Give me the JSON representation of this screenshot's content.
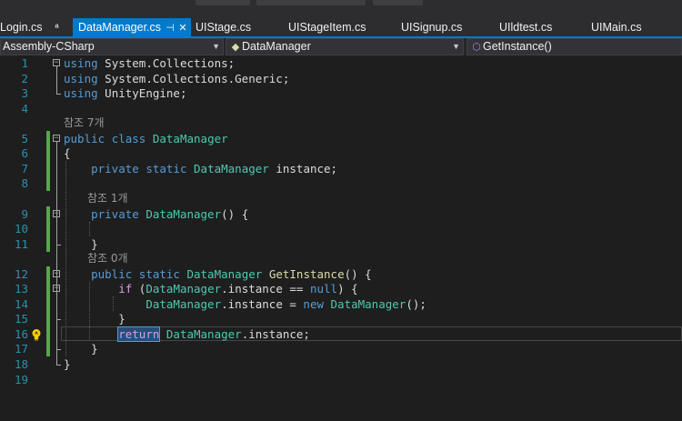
{
  "tabs": [
    {
      "label": "Login.cs",
      "pin": "๬",
      "active": false
    },
    {
      "label": "DataManager.cs",
      "active": true
    },
    {
      "label": "UIStage.cs",
      "active": false
    },
    {
      "label": "UIStageItem.cs",
      "active": false
    },
    {
      "label": "UISignup.cs",
      "active": false
    },
    {
      "label": "UIldtest.cs",
      "active": false
    },
    {
      "label": "UIMain.cs",
      "active": false
    }
  ],
  "navbar": {
    "project": "Assembly-CSharp",
    "class": "DataManager",
    "member": "GetInstance()"
  },
  "lines": [
    {
      "n": "1",
      "code": [
        [
          "k",
          "using"
        ],
        [
          "p",
          " System.Collections;"
        ]
      ]
    },
    {
      "n": "2",
      "code": [
        [
          "k",
          "using"
        ],
        [
          "p",
          " System.Collections.Generic;"
        ]
      ]
    },
    {
      "n": "3",
      "code": [
        [
          "k",
          "using"
        ],
        [
          "p",
          " UnityEngine;"
        ]
      ]
    },
    {
      "n": "4",
      "code": []
    },
    {
      "lens": "참조 7개"
    },
    {
      "n": "5",
      "code": [
        [
          "k",
          "public"
        ],
        [
          "p",
          " "
        ],
        [
          "k",
          "class"
        ],
        [
          "p",
          " "
        ],
        [
          "t",
          "DataManager"
        ]
      ]
    },
    {
      "n": "6",
      "code": [
        [
          "p",
          "{"
        ]
      ]
    },
    {
      "n": "7",
      "code": [
        [
          "p",
          "    "
        ],
        [
          "k",
          "private"
        ],
        [
          "p",
          " "
        ],
        [
          "k",
          "static"
        ],
        [
          "p",
          " "
        ],
        [
          "t",
          "DataManager"
        ],
        [
          "p",
          " instance;"
        ]
      ]
    },
    {
      "n": "8",
      "code": []
    },
    {
      "lens": "참조 1개"
    },
    {
      "n": "9",
      "code": [
        [
          "p",
          "    "
        ],
        [
          "k",
          "private"
        ],
        [
          "p",
          " "
        ],
        [
          "t",
          "DataManager"
        ],
        [
          "p",
          "() {"
        ]
      ]
    },
    {
      "n": "10",
      "code": []
    },
    {
      "n": "11",
      "code": [
        [
          "p",
          "    }"
        ]
      ]
    },
    {
      "lens": "참조 0개"
    },
    {
      "n": "12",
      "code": [
        [
          "p",
          "    "
        ],
        [
          "k",
          "public"
        ],
        [
          "p",
          " "
        ],
        [
          "k",
          "static"
        ],
        [
          "p",
          " "
        ],
        [
          "t",
          "DataManager"
        ],
        [
          "p",
          " "
        ],
        [
          "m",
          "GetInstance"
        ],
        [
          "p",
          "() {"
        ]
      ]
    },
    {
      "n": "13",
      "code": [
        [
          "p",
          "        "
        ],
        [
          "kc",
          "if"
        ],
        [
          "p",
          " ("
        ],
        [
          "t",
          "DataManager"
        ],
        [
          "p",
          ".instance == "
        ],
        [
          "k",
          "null"
        ],
        [
          "p",
          ") {"
        ]
      ]
    },
    {
      "n": "14",
      "code": [
        [
          "p",
          "            "
        ],
        [
          "t",
          "DataManager"
        ],
        [
          "p",
          ".instance = "
        ],
        [
          "k",
          "new"
        ],
        [
          "p",
          " "
        ],
        [
          "t",
          "DataManager"
        ],
        [
          "p",
          "();"
        ]
      ]
    },
    {
      "n": "15",
      "code": [
        [
          "p",
          "        }"
        ]
      ]
    },
    {
      "n": "16",
      "code": [
        [
          "p",
          "        "
        ],
        [
          "kc hl",
          "return"
        ],
        [
          "p",
          " "
        ],
        [
          "t",
          "DataManager"
        ],
        [
          "p",
          ".instance;"
        ]
      ]
    },
    {
      "n": "17",
      "code": [
        [
          "p",
          "    }"
        ]
      ]
    },
    {
      "n": "18",
      "code": [
        [
          "p",
          "}"
        ]
      ]
    },
    {
      "n": "19",
      "code": []
    }
  ],
  "colors": {
    "accent": "#007acc",
    "keyword": "#569cd6",
    "control_keyword": "#d8a0df",
    "type": "#4ec9b0",
    "method": "#dcdcaa",
    "line_number": "#2b91af",
    "change_marker": "#57a64a"
  },
  "icons": {
    "bulb": "lightbulb-icon",
    "class": "class-icon",
    "method": "method-icon"
  }
}
